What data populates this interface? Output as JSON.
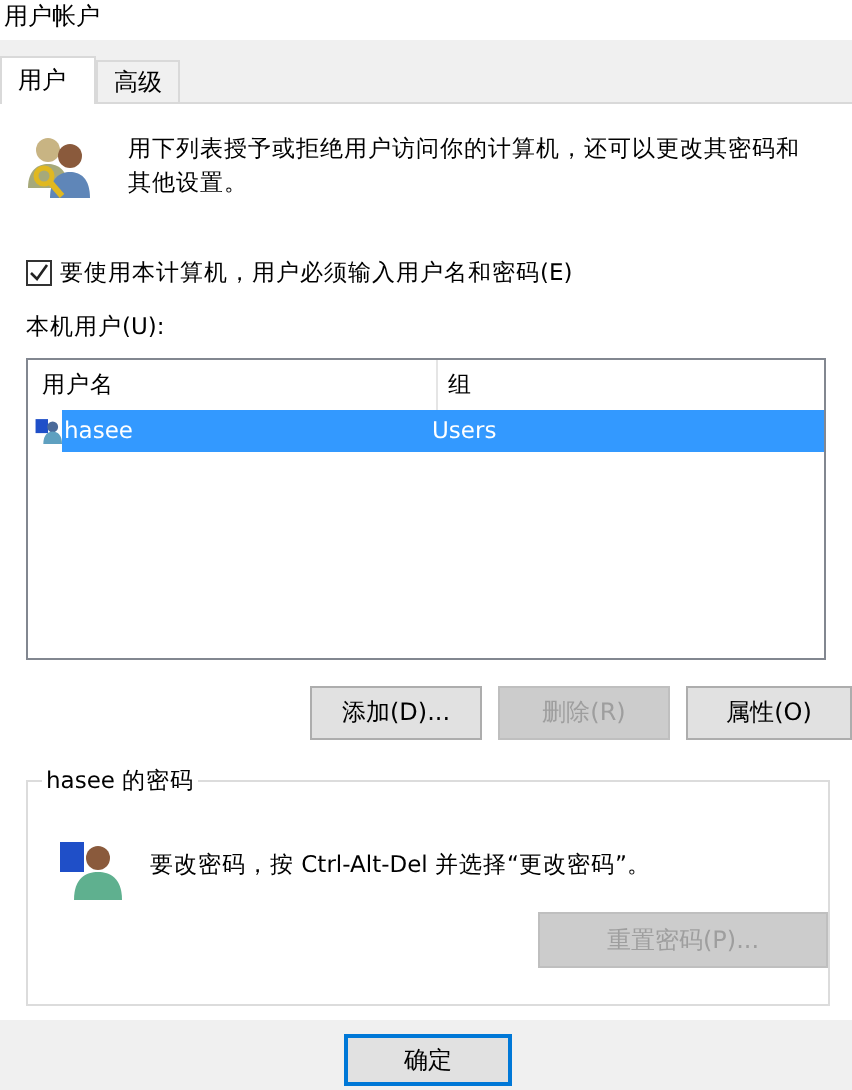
{
  "window": {
    "title": "用户帐户"
  },
  "tabs": [
    {
      "label": "用户",
      "selected": true
    },
    {
      "label": "高级",
      "selected": false
    }
  ],
  "intro": {
    "text": "用下列表授予或拒绝用户访问你的计算机，还可以更改其密码和其他设置。"
  },
  "require_password": {
    "label": "要使用本计算机，用户必须输入用户名和密码(E)",
    "checked": true
  },
  "users_label": "本机用户(U):",
  "table": {
    "columns": [
      "用户名",
      "组"
    ],
    "rows": [
      {
        "cells": [
          "hasee",
          "Users"
        ],
        "selected": true
      }
    ]
  },
  "user_buttons": [
    {
      "label": "添加(D)...",
      "disabled": false
    },
    {
      "label": "删除(R)",
      "disabled": true
    },
    {
      "label": "属性(O)",
      "disabled": false
    }
  ],
  "password_group": {
    "title": "hasee 的密码",
    "text": "要改密码，按 Ctrl-Alt-Del 并选择“更改密码”。",
    "button": {
      "label": "重置密码(P)...",
      "disabled": true
    }
  },
  "footer_buttons": [
    {
      "label": "确定",
      "default": true
    }
  ]
}
